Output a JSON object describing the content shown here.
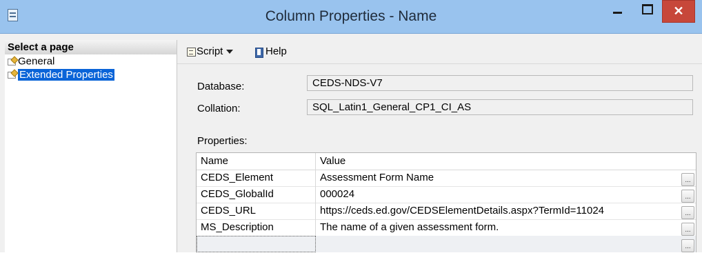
{
  "window": {
    "title": "Column Properties - Name",
    "close_glyph": "✕"
  },
  "left_pane": {
    "header": "Select a page",
    "pages": [
      {
        "label": "General",
        "selected": false,
        "icon": "page-settings-icon"
      },
      {
        "label": "Extended Properties",
        "selected": true,
        "icon": "page-settings-icon"
      }
    ]
  },
  "toolbar": {
    "script_label": "Script",
    "help_label": "Help"
  },
  "form": {
    "database_label": "Database:",
    "database_value": "CEDS-NDS-V7",
    "collation_label": "Collation:",
    "collation_value": "SQL_Latin1_General_CP1_CI_AS",
    "properties_label": "Properties:"
  },
  "grid": {
    "columns": [
      "Name",
      "Value"
    ],
    "ellipsis_label": "...",
    "rows": [
      {
        "name": "CEDS_Element",
        "value": "Assessment Form Name"
      },
      {
        "name": "CEDS_GlobalId",
        "value": "000024"
      },
      {
        "name": "CEDS_URL",
        "value": "https://ceds.ed.gov/CEDSElementDetails.aspx?TermId=11024"
      },
      {
        "name": "MS_Description",
        "value": "The name of a given assessment form."
      }
    ]
  },
  "colors": {
    "titlebar": "#99c3ee",
    "close_button": "#c7473a",
    "selection": "#0a64d8"
  }
}
